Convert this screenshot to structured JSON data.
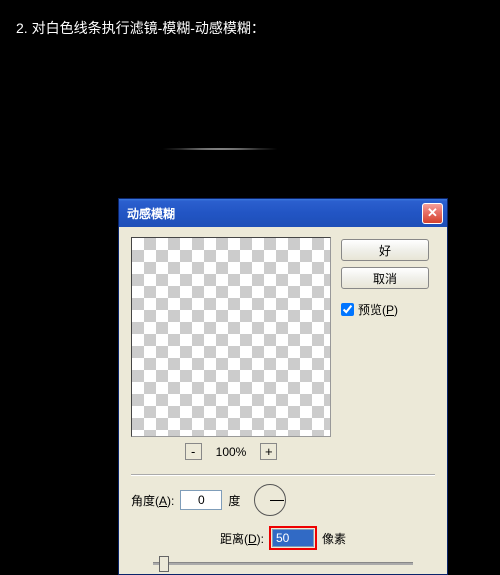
{
  "instruction": "2. 对白色线条执行滤镜-模糊-动感模糊：",
  "dialog": {
    "title": "动感模糊",
    "buttons": {
      "ok": "好",
      "cancel": "取消"
    },
    "preview_checkbox": {
      "label_pre": "预览(",
      "label_key": "P",
      "label_post": ")"
    },
    "zoom_percent": "100%",
    "angle": {
      "label_pre": "角度(",
      "label_key": "A",
      "label_post": "):",
      "value": "0",
      "unit": "度"
    },
    "distance": {
      "label_pre": "距离(",
      "label_key": "D",
      "label_post": "):",
      "value": "50",
      "unit": "像素"
    }
  }
}
